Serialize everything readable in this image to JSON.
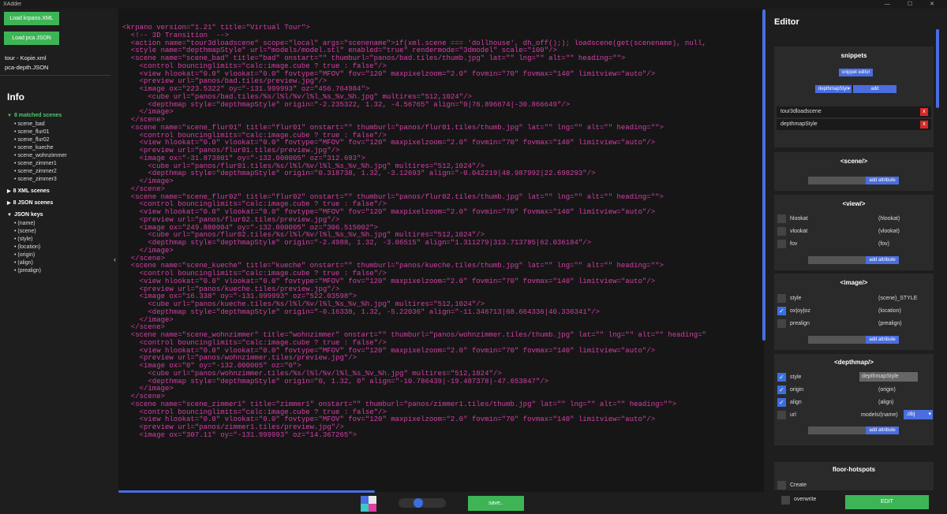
{
  "app": {
    "title": "XAdder",
    "window_controls": "— ☐ ✕"
  },
  "left": {
    "load_xml_label": "Load krpano.XML",
    "load_json_label": "Load pca JSON",
    "xml_file": "tour - Kopie.xml",
    "json_file": "pca-depth.JSON",
    "info_title": "Info",
    "matched_scenes_label": "8 matched scenes",
    "matched_scenes": [
      "scene_bad",
      "scene_flur01",
      "scene_flur02",
      "scene_kueche",
      "scene_wohnzimmer",
      "scene_zimmer1",
      "scene_zimmer2",
      "scene_zimmer3"
    ],
    "xml_scenes_label": "8 XML scenes",
    "json_scenes_label": "8 JSON scenes",
    "json_keys_label": "JSON keys",
    "json_keys": [
      "(name)",
      "(scene)",
      "(style)",
      "(location)",
      "(origin)",
      "(align)",
      "(prealign)"
    ]
  },
  "code": {
    "lines": [
      "<krpano version=\"1.21\" title=\"Virtual Tour\">",
      "  <!-- 3D Transition  -->",
      "  <action name=\"tour3dloadscene\" scope=\"local\" args=\"scenename\">if(xml.scene === 'dollhouse', dh_off();); loadscene(get(scenename), null,",
      "  <style name=\"depthmapStyle\" url=\"models/model.stl\" enabled=\"true\" rendermode=\"3dmodel\" scale=\"100\"/>",
      "  <scene name=\"scene_bad\" title=\"bad\" onstart=\"\" thumburl=\"panos/bad.tiles/thumb.jpg\" lat=\"\" lng=\"\" alt=\"\" heading=\"\">",
      "    <control bouncinglimits=\"calc:image.cube ? true : false\"/>",
      "    <view hlookat=\"0.0\" vlookat=\"0.0\" fovtype=\"MFOV\" fov=\"120\" maxpixelzoom=\"2.0\" fovmin=\"70\" fovmax=\"140\" limitview=\"auto\"/>",
      "    <preview url=\"panos/bad.tiles/preview.jpg\"/>",
      "    <image ox=\"223.5322\" oy=\"-131.999993\" oz=\"456.764984\">",
      "      <cube url=\"panos/bad.tiles/%s/l%l/%v/l%l_%s_%v_%h.jpg\" multires=\"512,1024\"/>",
      "      <depthmap style=\"depthmapStyle\" origin=\"-2.235322, 1.32, -4.56765\" align=\"0|76.896674|-30.866649\"/>",
      "    </image>",
      "  </scene>",
      "  <scene name=\"scene_flur01\" title=\"flur01\" onstart=\"\" thumburl=\"panos/flur01.tiles/thumb.jpg\" lat=\"\" lng=\"\" alt=\"\" heading=\"\">",
      "    <control bouncinglimits=\"calc:image.cube ? true : false\"/>",
      "    <view hlookat=\"0.0\" vlookat=\"0.0\" fovtype=\"MFOV\" fov=\"120\" maxpixelzoom=\"2.0\" fovmin=\"70\" fovmax=\"140\" limitview=\"auto\"/>",
      "    <preview url=\"panos/flur01.tiles/preview.jpg\"/>",
      "    <image ox=\"-31.873801\" oy=\"-132.000005\" oz=\"312.693\">",
      "      <cube url=\"panos/flur01.tiles/%s/l%l/%v/l%l_%s_%v_%h.jpg\" multires=\"512,1024\"/>",
      "      <depthmap style=\"depthmapStyle\" origin=\"0.318738, 1.32, -3.12693\" align=\"-0.042219|48.987992|22.698293\"/>",
      "    </image>",
      "  </scene>",
      "  <scene name=\"scene_flur02\" title=\"flur02\" onstart=\"\" thumburl=\"panos/flur02.tiles/thumb.jpg\" lat=\"\" lng=\"\" alt=\"\" heading=\"\">",
      "    <control bouncinglimits=\"calc:image.cube ? true : false\"/>",
      "    <view hlookat=\"0.0\" vlookat=\"0.0\" fovtype=\"MFOV\" fov=\"120\" maxpixelzoom=\"2.0\" fovmin=\"70\" fovmax=\"140\" limitview=\"auto\"/>",
      "    <preview url=\"panos/flur02.tiles/preview.jpg\"/>",
      "    <image ox=\"249.880004\" oy=\"-132.000005\" oz=\"306.515002\">",
      "      <cube url=\"panos/flur02.tiles/%s/l%l/%v/l%l_%s_%v_%h.jpg\" multires=\"512,1024\"/>",
      "      <depthmap style=\"depthmapStyle\" origin=\"-2.4988, 1.32, -3.06515\" align=\"1.311279|313.713785|62.036184\"/>",
      "    </image>",
      "  </scene>",
      "  <scene name=\"scene_kueche\" title=\"kueche\" onstart=\"\" thumburl=\"panos/kueche.tiles/thumb.jpg\" lat=\"\" lng=\"\" alt=\"\" heading=\"\">",
      "    <control bouncinglimits=\"calc:image.cube ? true : false\"/>",
      "    <view hlookat=\"0.0\" vlookat=\"0.0\" fovtype=\"MFOV\" fov=\"120\" maxpixelzoom=\"2.0\" fovmin=\"70\" fovmax=\"140\" limitview=\"auto\"/>",
      "    <preview url=\"panos/kueche.tiles/preview.jpg\"/>",
      "    <image ox=\"16.338\" oy=\"-131.999993\" oz=\"522.03598\">",
      "      <cube url=\"panos/kueche.tiles/%s/l%l/%v/l%l_%s_%v_%h.jpg\" multires=\"512,1024\"/>",
      "      <depthmap style=\"depthmapStyle\" origin=\"-0.16338, 1.32, -5.22036\" align=\"-11.346713|68.664336|40.336341\"/>",
      "    </image>",
      "  </scene>",
      "  <scene name=\"scene_wohnzimmer\" title=\"wohnzimmer\" onstart=\"\" thumburl=\"panos/wohnzimmer.tiles/thumb.jpg\" lat=\"\" lng=\"\" alt=\"\" heading=\"",
      "    <control bouncinglimits=\"calc:image.cube ? true : false\"/>",
      "    <view hlookat=\"0.0\" vlookat=\"0.0\" fovtype=\"MFOV\" fov=\"120\" maxpixelzoom=\"2.0\" fovmin=\"70\" fovmax=\"140\" limitview=\"auto\"/>",
      "    <preview url=\"panos/wohnzimmer.tiles/preview.jpg\"/>",
      "    <image ox=\"0\" oy=\"-132.000005\" oz=\"0\">",
      "      <cube url=\"panos/wohnzimmer.tiles/%s/l%l/%v/l%l_%s_%v_%h.jpg\" multires=\"512,1024\"/>",
      "      <depthmap style=\"depthmapStyle\" origin=\"0, 1.32, 0\" align=\"-10.786439|-19.487378|-47.653847\"/>",
      "    </image>",
      "  </scene>",
      "  <scene name=\"scene_zimmer1\" title=\"zimmer1\" onstart=\"\" thumburl=\"panos/zimmer1.tiles/thumb.jpg\" lat=\"\" lng=\"\" alt=\"\" heading=\"\">",
      "    <control bouncinglimits=\"calc:image.cube ? true : false\"/>",
      "    <view hlookat=\"0.0\" vlookat=\"0.0\" fovtype=\"MFOV\" fov=\"120\" maxpixelzoom=\"2.0\" fovmin=\"70\" fovmax=\"140\" limitview=\"auto\"/>",
      "    <preview url=\"panos/zimmer1.tiles/preview.jpg\"/>",
      "    <image ox=\"307.11\" oy=\"-131.999993\" oz=\"14.367265\">"
    ]
  },
  "bottom": {
    "save_label": "save.."
  },
  "editor": {
    "title": "Editor",
    "snippets": {
      "title": "snippets",
      "snippet_editor_label": "snippet editor",
      "selected_snippet": "depthmapStyl",
      "add_label": "add",
      "items": [
        "tour3dloadscene",
        "depthmapStyle"
      ],
      "remove_label": "x"
    },
    "scene": {
      "title": "<scene/>",
      "add_attribute_label": "add attribute"
    },
    "view": {
      "title": "<view/>",
      "rows": [
        {
          "name": "hlookat",
          "value": "(hlookat)",
          "checked": false
        },
        {
          "name": "vlookat",
          "value": "(vlookat)",
          "checked": false
        },
        {
          "name": "fov",
          "value": "(fov)",
          "checked": false
        }
      ],
      "add_attribute_label": "add attribute"
    },
    "image": {
      "title": "<image/>",
      "rows": [
        {
          "name": "style",
          "value": "(scene)_STYLE",
          "checked": false
        },
        {
          "name": "ox|oy|oz",
          "value": "(location)",
          "checked": true
        },
        {
          "name": "prealign",
          "value": "(prealign)",
          "checked": false
        }
      ],
      "add_attribute_label": "add attribute"
    },
    "depthmap": {
      "title": "<depthmap/>",
      "rows": [
        {
          "name": "style",
          "value": "depthmapStyle",
          "checked": true
        },
        {
          "name": "origin",
          "value": "(origin)",
          "checked": true
        },
        {
          "name": "align",
          "value": "(align)",
          "checked": true
        },
        {
          "name": "url",
          "value": "models/(name)",
          "checked": false
        }
      ],
      "url_ext": ".obj",
      "add_attribute_label": "add attribute"
    },
    "floor_hotspots": {
      "title": "floor-hotspots",
      "create_label": "Create"
    },
    "overwrite_label": "overwrite",
    "edit_label": "EDIT"
  },
  "colors": {
    "green": "#3db556",
    "blue": "#4a6ee0",
    "code": "#d43fa8",
    "red": "#d92727"
  }
}
